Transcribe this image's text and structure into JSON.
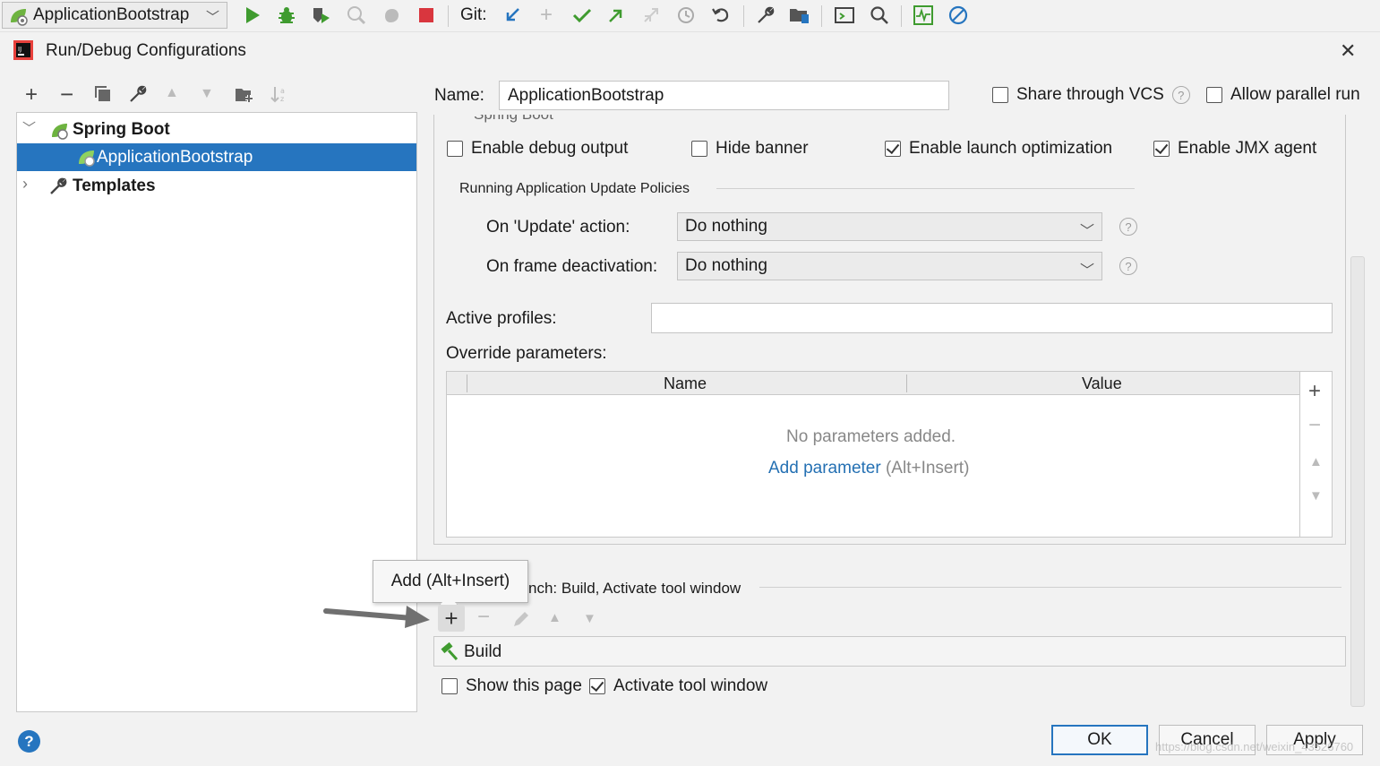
{
  "toolbar": {
    "run_config": "ApplicationBootstrap",
    "git_label": "Git:"
  },
  "dialog": {
    "title": "Run/Debug Configurations",
    "close": "✕"
  },
  "tree": {
    "group": "Spring Boot",
    "selected_item": "ApplicationBootstrap",
    "templates": "Templates"
  },
  "form": {
    "name_label": "Name:",
    "name_value": "ApplicationBootstrap",
    "share_vcs": "Share through VCS",
    "allow_parallel": "Allow parallel run",
    "section_partial": "Spring Boot",
    "enable_debug": "Enable debug output",
    "hide_banner": "Hide banner",
    "enable_launch_opt": "Enable launch optimization",
    "enable_jmx": "Enable JMX agent",
    "update_policies_title": "Running Application Update Policies",
    "on_update_label": "On 'Update' action:",
    "on_update_value": "Do nothing",
    "on_frame_label": "On frame deactivation:",
    "on_frame_value": "Do nothing",
    "active_profiles_label": "Active profiles:",
    "active_profiles_value": "",
    "override_label": "Override parameters:",
    "col_name": "Name",
    "col_value": "Value",
    "empty_text": "No parameters added.",
    "add_param_link": "Add parameter",
    "add_param_hint": "(Alt+Insert)",
    "before_launch_partial": "nch: Build, Activate tool window",
    "tooltip": "Add (Alt+Insert)",
    "build_item": "Build",
    "show_page": "Show this page",
    "activate_tool": "Activate tool window"
  },
  "buttons": {
    "ok": "OK",
    "cancel": "Cancel",
    "apply": "Apply",
    "help": "?"
  },
  "watermark": "https://blog.csdn.net/weixin_43526760",
  "colors": {
    "selection": "#2675bf",
    "link": "#2470b3",
    "green": "#3f9b2f",
    "red": "#d9363e"
  }
}
